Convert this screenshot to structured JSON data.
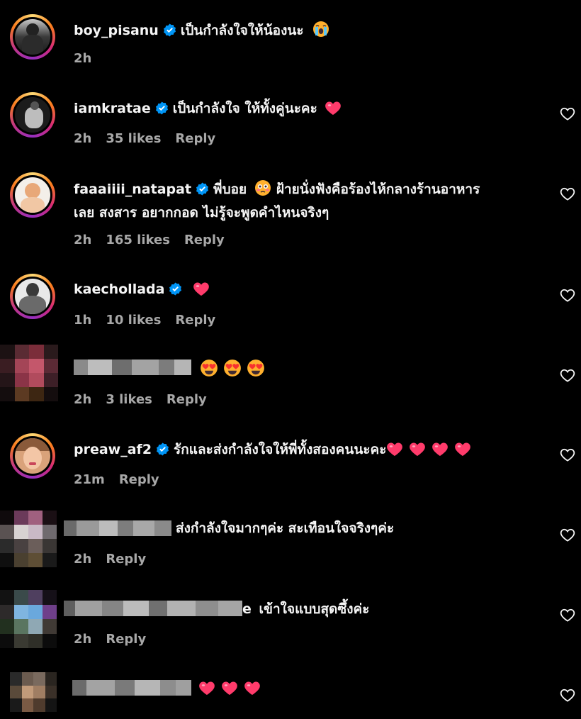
{
  "comments": [
    {
      "username": "boy_pisanu",
      "text": "เป็นกำลังใจให้น้องนะ",
      "emoji": "crying-face",
      "time": "2h",
      "likes": "",
      "reply": ""
    },
    {
      "username": "iamkratae",
      "text": "เป็นกำลังใจ ให้ทั้งคู่นะคะ",
      "emoji": "heart",
      "time": "2h",
      "likes": "35 likes",
      "reply": "Reply"
    },
    {
      "username": "faaaiiii_natapat",
      "text": "พี่บอย",
      "text_after_emoji": "ฝ้ายนั่งฟังคือร้องไห้กลางร้านอาหาร",
      "text_line2": "เลย สงสาร อยากกอด ไม่รู้จะพูดคำไหนจริงๆ",
      "emoji": "flushed-face",
      "time": "2h",
      "likes": "165 likes",
      "reply": "Reply"
    },
    {
      "username": "kaechollada",
      "emoji": "heart",
      "time": "1h",
      "likes": "10 likes",
      "reply": "Reply"
    },
    {
      "username_hidden": true,
      "emoji": "heart-eyes-x3",
      "time": "2h",
      "likes": "3 likes",
      "reply": "Reply"
    },
    {
      "username": "preaw_af2",
      "text": "รักและส่งกำลังใจให้พี่ทั้งสองคนนะคะ",
      "emoji": "heart-x4",
      "time": "21m",
      "likes": "",
      "reply": "Reply"
    },
    {
      "username_hidden": true,
      "text": "ส่งกำลังใจมากๆค่ะ สะเทือนใจจริงๆค่ะ",
      "time": "2h",
      "likes": "",
      "reply": "Reply"
    },
    {
      "username_hidden": true,
      "username_tail": "e",
      "text": "เข้าใจแบบสุดซึ้งค่ะ",
      "time": "2h",
      "likes": "",
      "reply": "Reply"
    },
    {
      "username_hidden": true,
      "emoji": "heart-x3",
      "time": "",
      "likes": "",
      "reply": ""
    }
  ],
  "colors": {
    "background": "#000000",
    "text": "#f5f5f5",
    "meta": "#a8a8a8",
    "verified": "#0095f6",
    "heart": "#ff3b6b"
  }
}
